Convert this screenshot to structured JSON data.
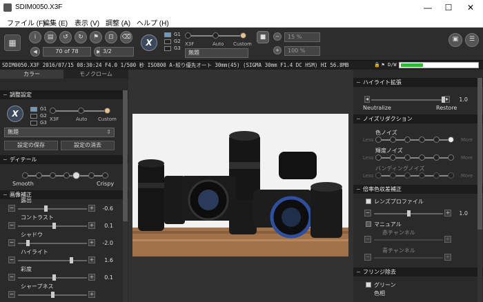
{
  "window": {
    "title": "SDIM0050.X3F",
    "min": "—",
    "max": "☐",
    "close": "✕"
  },
  "menu": [
    "ファイル (F)",
    "編集 (E)",
    "表示 (V)",
    "調整 (A)",
    "ヘルプ (H)"
  ],
  "toolbar": {
    "frame": "70 of 78",
    "ratio": "3/2",
    "g_labels": [
      "G1",
      "G2",
      "G3"
    ],
    "mode_labels": [
      "X3F",
      "Auto",
      "Custom"
    ],
    "preset": "無題",
    "zoom1": "15 %",
    "zoom2": "100 %"
  },
  "status": {
    "info": "SDIM0050.X3F 2016/07/15 08:30:24 F4.0 1/500 秒 ISO800 A-絞り優先オート 30mm(45) (SIGMA 30mm F1.4 DC HSM) HI 56.8MB",
    "dw": "D/W"
  },
  "left": {
    "tabs": [
      "カラー",
      "モノクローム"
    ],
    "adjust_header": "調整設定",
    "g_labels": [
      "G1",
      "G2",
      "G3"
    ],
    "mode_labels": [
      "X3F",
      "Auto",
      "Custom"
    ],
    "preset": "無題",
    "save_button": "設定の保存",
    "delete_button": "設定の消去",
    "detail_header": "ディテール",
    "detail_left": "Smooth",
    "detail_right": "Crispy",
    "image_header": "画像補正",
    "sliders": [
      {
        "label": "露出",
        "value": "-0.6",
        "level": 0.4
      },
      {
        "label": "コントラスト",
        "value": "0.1",
        "level": 0.52
      },
      {
        "label": "シャドウ",
        "value": "-2.0",
        "level": 0.12
      },
      {
        "label": "ハイライト",
        "value": "1.6",
        "level": 0.78
      },
      {
        "label": "彩度",
        "value": "0.1",
        "level": 0.52
      },
      {
        "label": "シャープネス",
        "value": "",
        "level": 0.5
      }
    ]
  },
  "right": {
    "highlight_header": "ハイライト拡張",
    "highlight_value": "1.0",
    "neutralize": "Neutralize",
    "restore": "Restore",
    "noise_header": "ノイズリダクション",
    "noise_rows": [
      {
        "label": "色ノイズ",
        "less": "Less",
        "more": "More"
      },
      {
        "label": "輝度ノイズ",
        "less": "Less",
        "more": "More"
      },
      {
        "label": "バンディングノイズ",
        "less": "Less",
        "more": "More"
      }
    ],
    "lens_header": "倍率色収差補正",
    "lens_profile": "レンズプロファイル",
    "lens_value": "1.0",
    "manual": "マニュアル",
    "red_channel": "赤チャンネル",
    "blue_channel": "青チャンネル",
    "fringe_header": "フリンジ除去",
    "green": "グリーン",
    "hue": "色相"
  }
}
